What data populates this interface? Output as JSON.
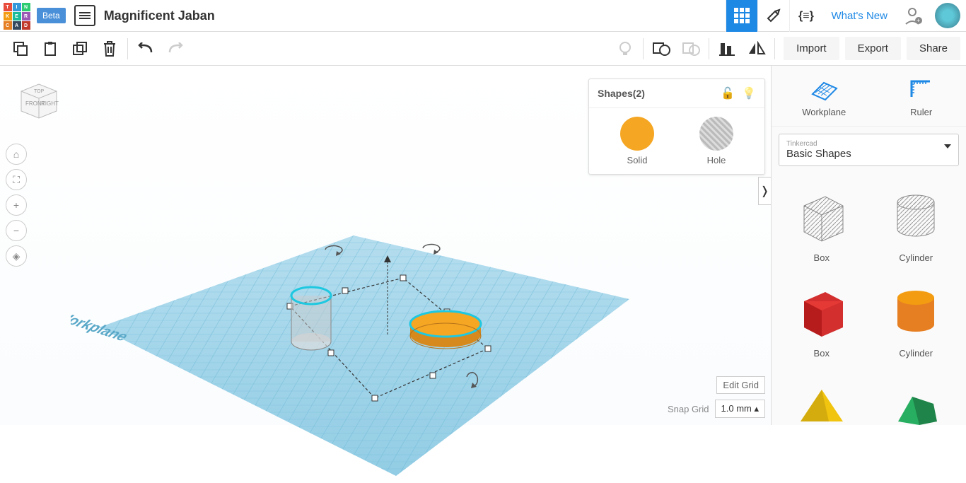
{
  "header": {
    "beta": "Beta",
    "title": "Magnificent Jaban",
    "whatsnew": "What's New"
  },
  "toolbar": {
    "import": "Import",
    "export": "Export",
    "share": "Share"
  },
  "shapes_panel": {
    "title": "Shapes(2)",
    "solid": "Solid",
    "hole": "Hole"
  },
  "grid_controls": {
    "edit": "Edit Grid",
    "snap_label": "Snap Grid",
    "snap_value": "1.0 mm"
  },
  "sidebar": {
    "workplane": "Workplane",
    "ruler": "Ruler",
    "dd_category": "Tinkercad",
    "dd_value": "Basic Shapes",
    "shapes": [
      {
        "label": "Box",
        "type": "box-hatched"
      },
      {
        "label": "Cylinder",
        "type": "cyl-hatched"
      },
      {
        "label": "Box",
        "type": "box-red"
      },
      {
        "label": "Cylinder",
        "type": "cyl-orange"
      },
      {
        "label": "",
        "type": "pyramid-yellow"
      },
      {
        "label": "",
        "type": "prism-green"
      }
    ]
  },
  "viewcube": {
    "front": "FRONT",
    "right": "RIGHT",
    "top": "TOP"
  },
  "workplane_label": "Workplane"
}
